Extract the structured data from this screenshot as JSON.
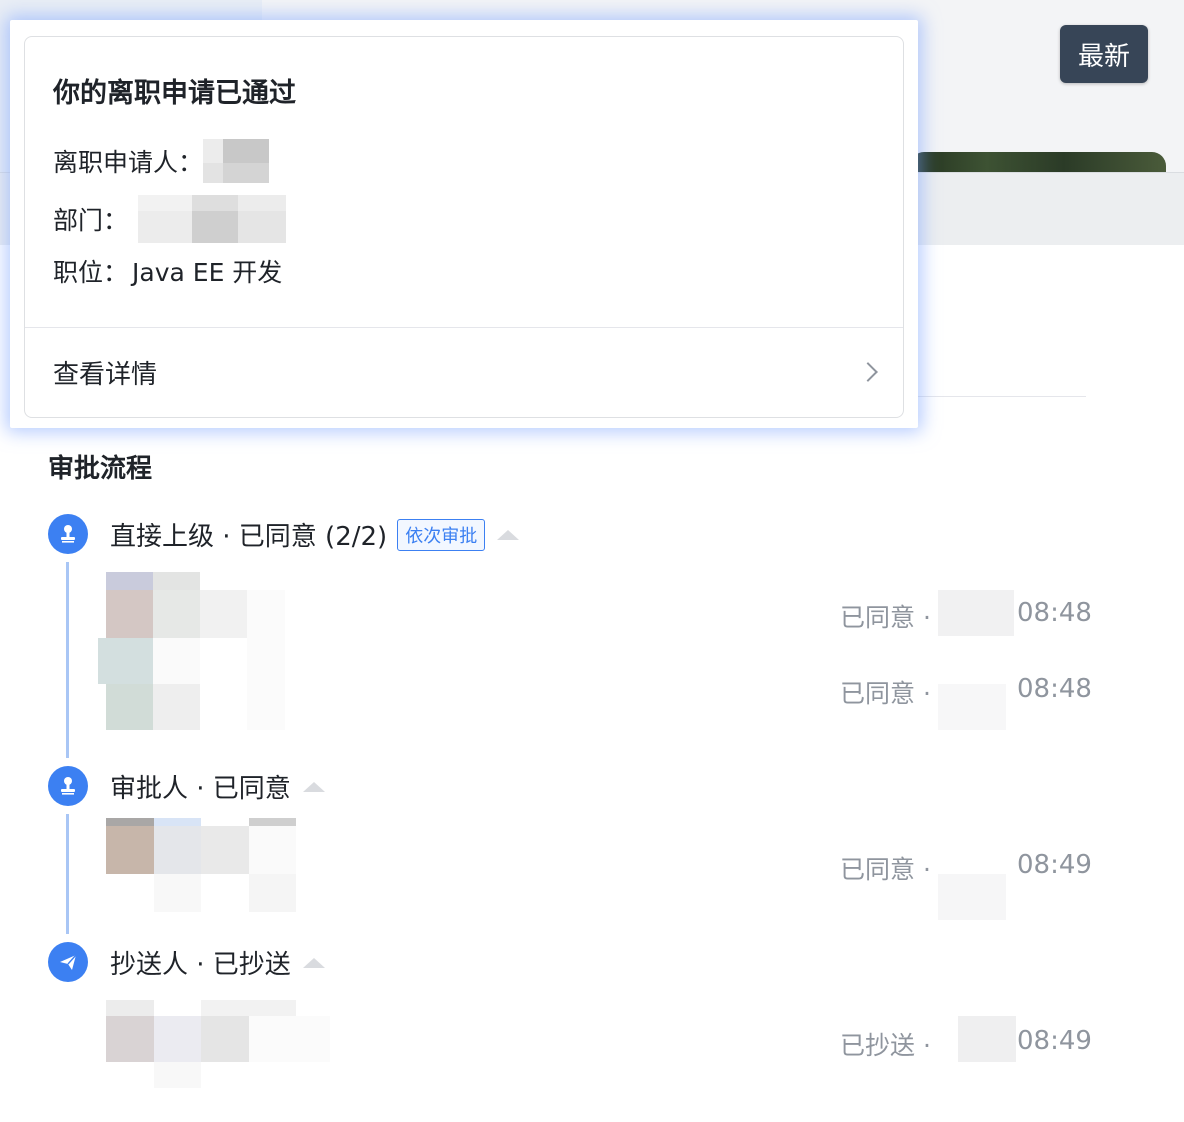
{
  "header": {
    "latest_button": "最新"
  },
  "popup": {
    "title": "你的离职申请已通过",
    "applicant_label": "离职申请人：",
    "department_label": "部门：",
    "position_label": "职位：",
    "position_value": "Java EE 开发",
    "detail_link": "查看详情"
  },
  "approval": {
    "section_title": "审批流程",
    "nodes": [
      {
        "title": "直接上级 · 已同意 (2/2)",
        "tag": "依次审批",
        "icon": "stamp-icon",
        "records": [
          {
            "status": "已同意 ·",
            "time": "08:48"
          },
          {
            "status": "已同意 ·",
            "time": "08:48"
          }
        ]
      },
      {
        "title": "审批人 · 已同意",
        "icon": "stamp-icon",
        "records": [
          {
            "status": "已同意 ·",
            "time": "08:49"
          }
        ]
      },
      {
        "title": "抄送人 · 已抄送",
        "icon": "send-icon",
        "records": [
          {
            "status": "已抄送 ·",
            "time": "08:49"
          }
        ]
      }
    ]
  },
  "colors": {
    "accent": "#3c80f2",
    "timeline": "#a9c6f5",
    "button_bg": "#374557",
    "muted_text": "#8f959e"
  }
}
